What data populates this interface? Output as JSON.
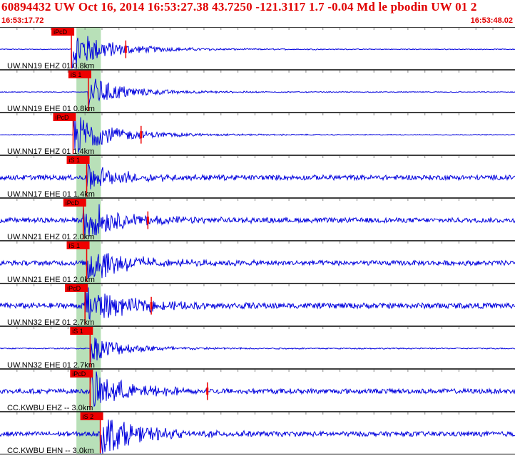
{
  "header": {
    "title": "60894432 UW Oct 16, 2014 16:53:27.38   43.7250 -121.3117  1.7 -0.04 Md le pbodin UW 01   2",
    "time_start": "16:53:17.72",
    "time_end": "16:53:48.02"
  },
  "colors": {
    "header_text": "#e00000",
    "trace": "#0000dd",
    "pick": "#ee0000",
    "window": "#b8e0b8",
    "tick": "#888888"
  },
  "traces": [
    {
      "label": "UW.NN19 EHZ 01 0.8km",
      "pick_label": "iPcD",
      "pick_time": 4.2,
      "noise": 0.02,
      "amp": 0.95,
      "secondary": 7.4
    },
    {
      "label": "UW.NN19 EHE 01 0.8km",
      "pick_label": "iS 1",
      "pick_time": 5.2,
      "noise": 0.02,
      "amp": 0.7,
      "secondary": null
    },
    {
      "label": "UW.NN17 EHZ 01 1.4km",
      "pick_label": "iPcD",
      "pick_time": 4.3,
      "noise": 0.02,
      "amp": 0.95,
      "secondary": 8.3
    },
    {
      "label": "UW.NN17 EHE 01 1.4km",
      "pick_label": "iS 1",
      "pick_time": 5.1,
      "noise": 0.12,
      "amp": 0.6,
      "secondary": null
    },
    {
      "label": "UW.NN21 EHZ 01 2.0km",
      "pick_label": "iPcD",
      "pick_time": 4.9,
      "noise": 0.12,
      "amp": 0.95,
      "secondary": 8.7
    },
    {
      "label": "UW.NN21 EHE 01 2.0km",
      "pick_label": "iS 1",
      "pick_time": 5.1,
      "noise": 0.12,
      "amp": 0.9,
      "secondary": null
    },
    {
      "label": "UW.NN32 EHZ 01 2.7km",
      "pick_label": "iPcD",
      "pick_time": 5.0,
      "noise": 0.14,
      "amp": 0.95,
      "secondary": 8.9
    },
    {
      "label": "UW.NN32 EHE 01 2.7km",
      "pick_label": "iS 1",
      "pick_time": 5.3,
      "noise": 0.03,
      "amp": 0.6,
      "secondary": null
    },
    {
      "label": "CC.KWBU EHZ -- 3.0km",
      "pick_label": "iPcD",
      "pick_time": 5.3,
      "noise": 0.12,
      "amp": 0.95,
      "secondary": 12.2
    },
    {
      "label": "CC.KWBU EHN -- 3.0km",
      "pick_label": "iS 2",
      "pick_time": 5.9,
      "noise": 0.12,
      "amp": 0.95,
      "secondary": null
    }
  ],
  "time_window": {
    "start": 0,
    "end": 30.3,
    "green_start": 5.0,
    "green_end": 5.6
  }
}
